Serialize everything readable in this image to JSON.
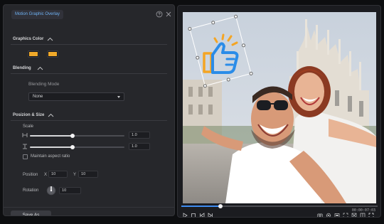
{
  "panel": {
    "title": "Motion Graphic Overlay",
    "graphics_color": {
      "title": "Graphics Color",
      "colors": [
        "#f0a92a",
        "#f0a92a"
      ]
    },
    "blending": {
      "title": "Blending",
      "mode_label": "Blending Mode",
      "mode_value": "None"
    },
    "position_size": {
      "title": "Posizion & Size",
      "scale_label": "Scale",
      "scale_h": {
        "value": "1.0",
        "fraction": 0.45
      },
      "scale_v": {
        "value": "1.0",
        "fraction": 0.45
      },
      "aspect_label": "Maintain aspect ratio",
      "position_label": "Position",
      "x_label": "X",
      "x_value": "10",
      "y_label": "Y",
      "y_value": "10",
      "rotation_label": "Rotation",
      "rotation_value": "10"
    },
    "save_label": "Save As"
  },
  "preview": {
    "timecode": "00:00:07:03",
    "progress_fraction": 0.2,
    "controls": [
      "play-icon",
      "stop-icon",
      "prev-frame-icon",
      "next-frame-icon"
    ],
    "tools": [
      "camera-icon",
      "settings-icon",
      "aspect-icon",
      "fullscreen-icon",
      "zoom-icon",
      "layout-icon",
      "expand-icon"
    ]
  },
  "colors": {
    "accent": "#3f8cf0",
    "title_accent": "#6fb2f4",
    "sticker_orange": "#f4a524",
    "sticker_blue": "#2b8ce8"
  }
}
